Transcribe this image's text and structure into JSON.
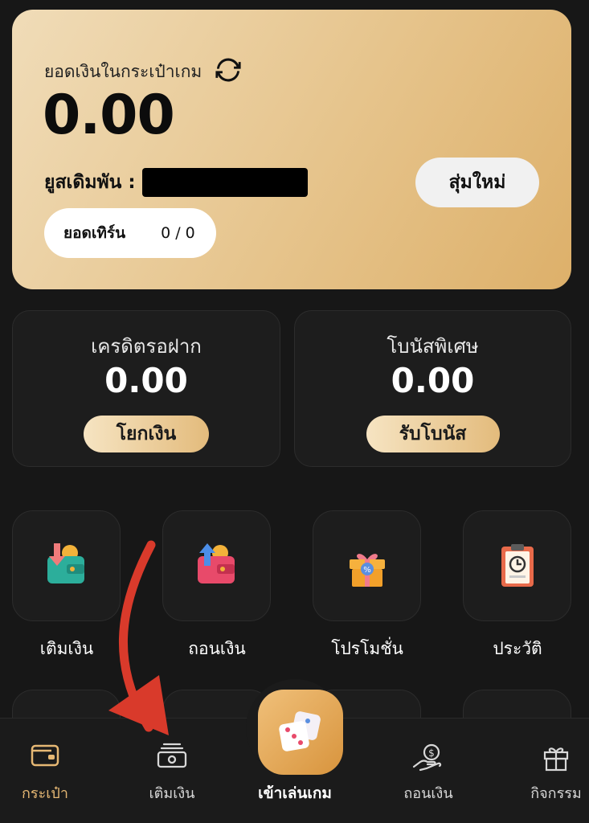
{
  "wallet": {
    "title": "ยอดเงินในกระเป๋าเกม",
    "balance": "0.00",
    "user_label": "ยูสเดิมพัน :",
    "random_button": "สุ่มใหม่",
    "turnover_label": "ยอดเทิร์น",
    "turnover_value": "0 / 0"
  },
  "stats": {
    "credit": {
      "label": "เครดิตรอฝาก",
      "value": "0.00",
      "button": "โยกเงิน"
    },
    "bonus": {
      "label": "โบนัสพิเศษ",
      "value": "0.00",
      "button": "รับโบนัส"
    }
  },
  "menu": [
    {
      "label": "เติมเงิน",
      "icon": "deposit-wallet-icon"
    },
    {
      "label": "ถอนเงิน",
      "icon": "withdraw-wallet-icon"
    },
    {
      "label": "โปรโมชั่น",
      "icon": "gift-icon"
    },
    {
      "label": "ประวัติ",
      "icon": "history-clipboard-icon"
    }
  ],
  "bottom_nav": {
    "wallet": "กระเป๋า",
    "deposit": "เติมเงิน",
    "play": "เข้าเล่นเกม",
    "withdraw": "ถอนเงิน",
    "activity": "กิจกรรม"
  },
  "colors": {
    "background": "#171717",
    "gold_accent": "#e6b874",
    "card": "#1d1d1d",
    "annotation_arrow": "#d93a2b"
  }
}
